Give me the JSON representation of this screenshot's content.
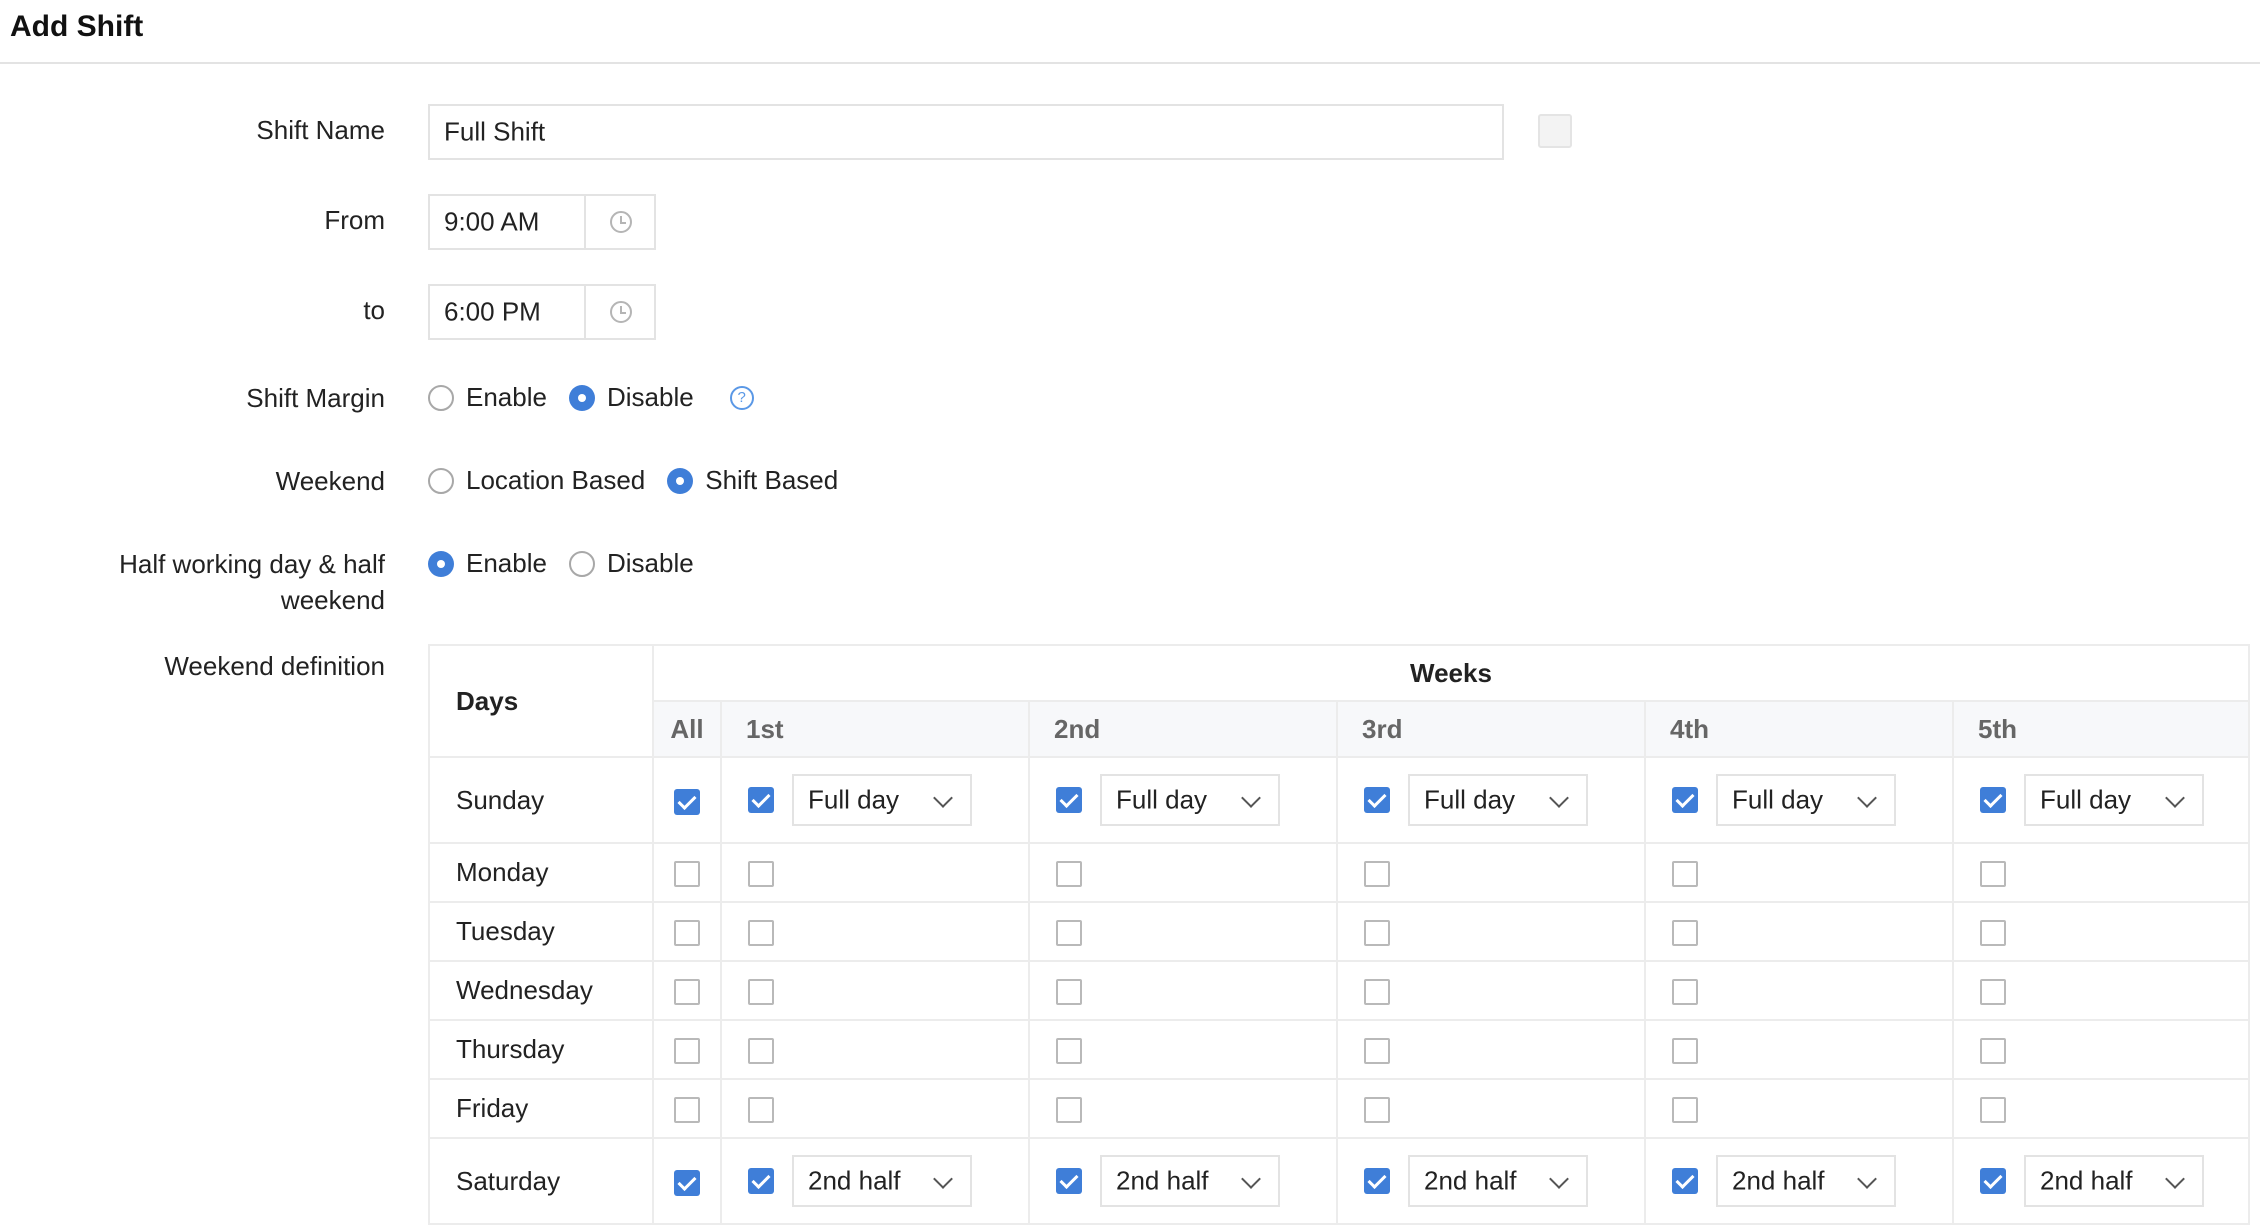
{
  "header": {
    "title": "Add Shift"
  },
  "form": {
    "shift_name_label": "Shift Name",
    "shift_name_value": "Full Shift",
    "from_label": "From",
    "from_value": "9:00 AM",
    "to_label": "to",
    "to_value": "6:00 PM",
    "shift_margin_label": "Shift Margin",
    "shift_margin_options": [
      "Enable",
      "Disable"
    ],
    "shift_margin_selected": "Disable",
    "weekend_label": "Weekend",
    "weekend_options": [
      "Location Based",
      "Shift Based"
    ],
    "weekend_selected": "Shift Based",
    "half_day_label_line1": "Half working day & half",
    "half_day_label_line2": "weekend",
    "half_day_options": [
      "Enable",
      "Disable"
    ],
    "half_day_selected": "Enable",
    "weekend_definition_label": "Weekend definition"
  },
  "table": {
    "days_header": "Days",
    "weeks_header": "Weeks",
    "week_columns": [
      "All",
      "1st",
      "2nd",
      "3rd",
      "4th",
      "5th"
    ],
    "rows": [
      {
        "day": "Sunday",
        "checked": true,
        "select": "Full day"
      },
      {
        "day": "Monday",
        "checked": false,
        "select": ""
      },
      {
        "day": "Tuesday",
        "checked": false,
        "select": ""
      },
      {
        "day": "Wednesday",
        "checked": false,
        "select": ""
      },
      {
        "day": "Thursday",
        "checked": false,
        "select": ""
      },
      {
        "day": "Friday",
        "checked": false,
        "select": ""
      },
      {
        "day": "Saturday",
        "checked": true,
        "select": "2nd half"
      }
    ]
  },
  "icons": {
    "clock": "clock-icon",
    "help": "help-icon",
    "chevron": "chevron-down-icon"
  },
  "colors": {
    "accent": "#3f7ed8",
    "border": "#e3e3e3"
  }
}
